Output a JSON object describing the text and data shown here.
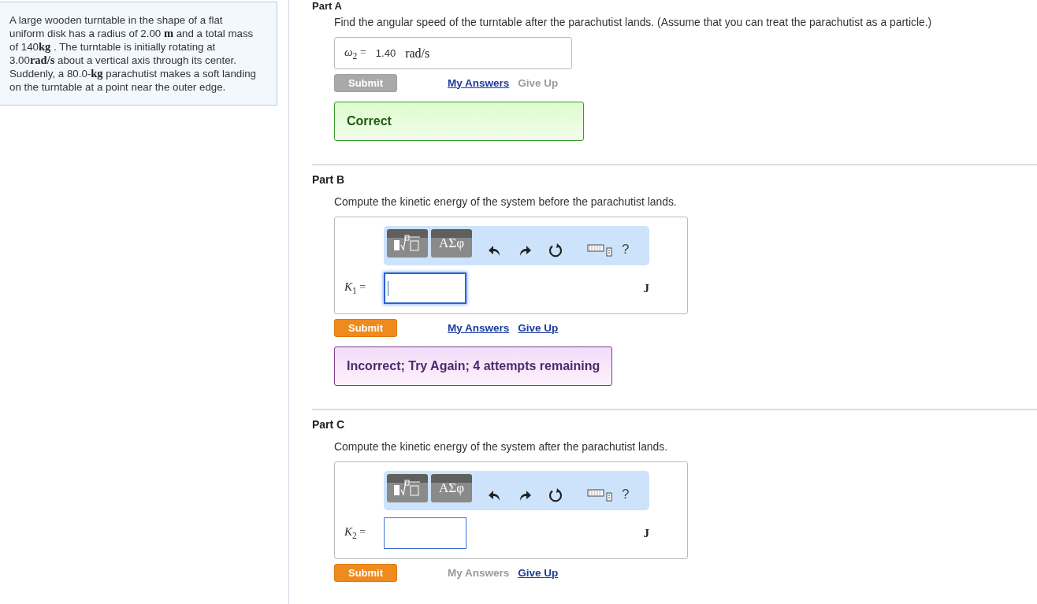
{
  "problem": {
    "text": "A large wooden turntable in the shape of a flat uniform disk has a radius of 2.00 **m** and a total mass of 140**kg** . The turntable is initially rotating at 3.00**rad/s** about a vertical axis through its center. Suddenly, a 80.0-**kg** parachutist makes a soft landing on the turntable at a point near the outer edge."
  },
  "parts": [
    {
      "title": "Part A",
      "prompt": "Find the angular speed of the turntable after the parachutist lands. (Assume that you can treat the parachutist as a particle.)",
      "answer": {
        "kind": "answered",
        "label": "*ω*$_{2}$ =",
        "value": "1.40",
        "unit": "rad/s"
      },
      "submit": {
        "label": "Submit",
        "disabled": true
      },
      "my_answers": {
        "label": "My Answers",
        "disabled": false
      },
      "give_up": {
        "label": "Give Up",
        "disabled": true
      },
      "feedback": {
        "kind": "correct",
        "text": "Correct"
      }
    },
    {
      "title": "Part B",
      "prompt": "Compute the kinetic energy of the system before the parachutist lands.",
      "answer": {
        "kind": "editor",
        "toolbar": {
          "symbols": "ΑΣφ",
          "help": "?"
        },
        "label": "*K*$_{1}$ =",
        "focused": true,
        "unit": "J"
      },
      "submit": {
        "label": "Submit",
        "disabled": false
      },
      "my_answers": {
        "label": "My Answers",
        "disabled": false
      },
      "give_up": {
        "label": "Give Up",
        "disabled": false
      },
      "feedback": {
        "kind": "incorrect",
        "text": "Incorrect; Try Again; 4 attempts remaining"
      }
    },
    {
      "title": "Part C",
      "prompt": "Compute the kinetic energy of the system after the parachutist lands.",
      "answer": {
        "kind": "editor",
        "toolbar": {
          "symbols": "ΑΣφ",
          "help": "?"
        },
        "label": "*K*$_{2}$ =",
        "focused": false,
        "unit": "J"
      },
      "submit": {
        "label": "Submit",
        "disabled": false
      },
      "my_answers": {
        "label": "My Answers",
        "disabled": true
      },
      "give_up": {
        "label": "Give Up",
        "disabled": false
      }
    }
  ]
}
